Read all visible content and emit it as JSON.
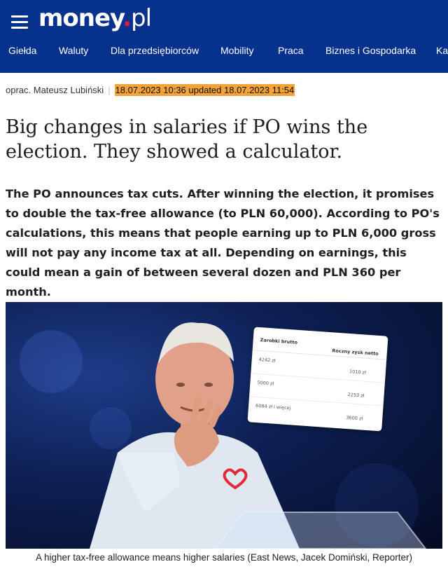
{
  "header": {
    "logo_main": "money",
    "logo_dot": ".",
    "logo_tld": "pl",
    "nav": [
      "Giełda",
      "Waluty",
      "Dla przedsiębiorców",
      "Mobility",
      "Praca",
      "Biznes i Gospodarka",
      "Ka"
    ]
  },
  "article": {
    "author": "oprac. Mateusz Lubiński",
    "separator": "|",
    "dates": "18.07.2023 10:36 updated 18.07.2023 11:54",
    "title": "Big changes in salaries if PO wins the election. They showed a calculator.",
    "lead": "The PO announces tax cuts. After winning the election, it promises to double the tax-free allowance (to PLN 60,000). According to PO's calculations, this means that people earning up to PLN 6,000 gross will not pay any income tax at all. Depending on earnings, this could mean a gain of between several dozen and PLN 360 per month.",
    "image": {
      "table": {
        "col1": "Zarobki brutto",
        "col2": "Roczny zysk netto",
        "rows": [
          {
            "salary": "4242 zł",
            "gain": "1010 zł"
          },
          {
            "salary": "5000 zł",
            "gain": "2253 zł"
          },
          {
            "salary": "6084 zł i więcej",
            "gain": "3600 zł"
          }
        ]
      },
      "caption": "A higher tax-free allowance means higher salaries (East News, Jacek Domiński, Reporter)"
    }
  },
  "colors": {
    "header_bg": "#06318c",
    "logo_dot": "#e8173b",
    "date_highlight": "#f4a23a"
  }
}
